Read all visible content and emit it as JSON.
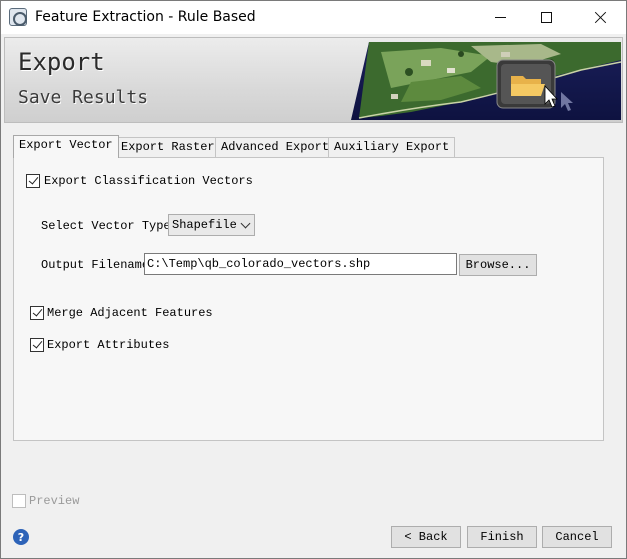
{
  "window": {
    "title": "Feature Extraction - Rule Based"
  },
  "header": {
    "title": "Export",
    "subtitle": "Save Results",
    "image_icon": "folder-icon"
  },
  "tabs": [
    {
      "label": "Export Vector",
      "active": true
    },
    {
      "label": "Export Raster",
      "active": false
    },
    {
      "label": "Advanced Export",
      "active": false
    },
    {
      "label": "Auxiliary Export",
      "active": false
    }
  ],
  "export_vector": {
    "export_classification_vectors": {
      "label": "Export Classification Vectors",
      "checked": true
    },
    "vector_type": {
      "label": "Select Vector Type",
      "value": "Shapefile"
    },
    "output_filename": {
      "label": "Output Filename",
      "value": "C:\\Temp\\qb_colorado_vectors.shp",
      "browse_label": "Browse..."
    },
    "merge_adjacent": {
      "label": "Merge Adjacent Features",
      "checked": true
    },
    "export_attributes": {
      "label": "Export Attributes",
      "checked": true
    }
  },
  "footer": {
    "preview": {
      "label": "Preview",
      "checked": false,
      "enabled": false
    },
    "back_label": "< Back",
    "finish_label": "Finish",
    "cancel_label": "Cancel",
    "help_icon": "?"
  }
}
